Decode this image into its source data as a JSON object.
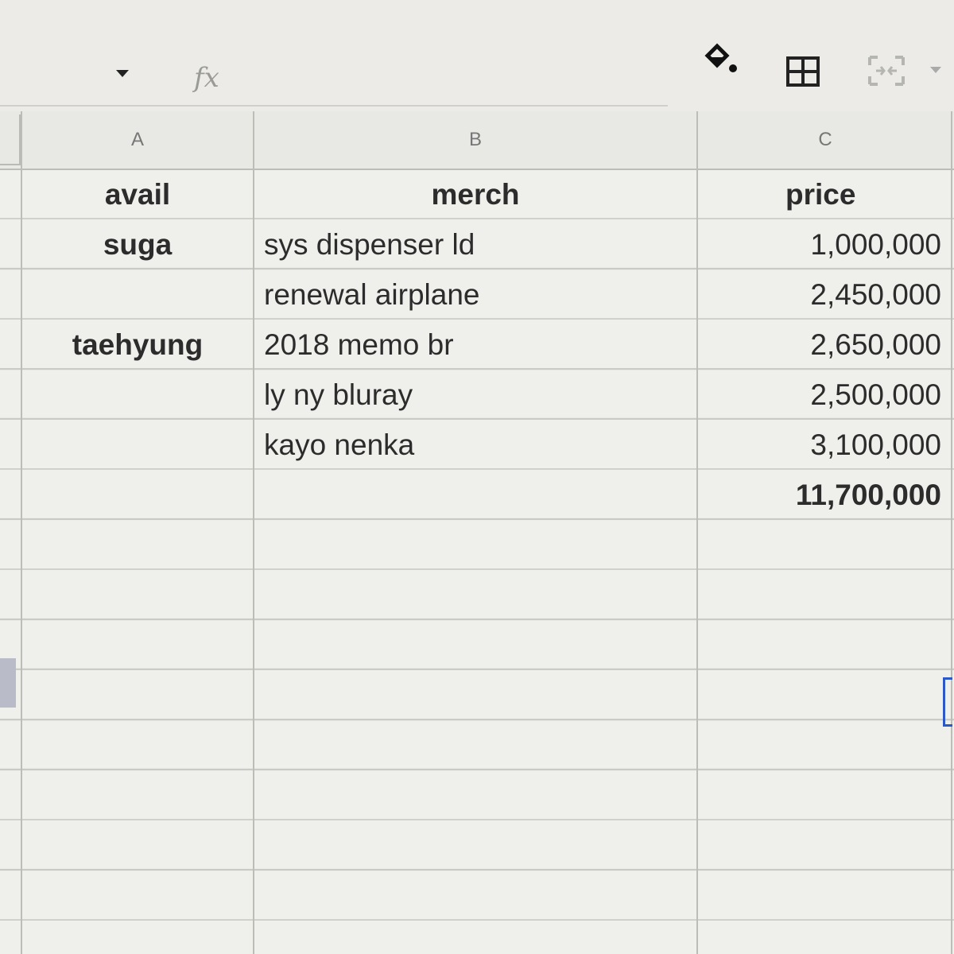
{
  "toolbar": {
    "fx_label": "fx",
    "icons": [
      "dropdown-arrow-icon",
      "fx-icon",
      "paint-format-icon",
      "borders-icon",
      "merge-cells-icon"
    ]
  },
  "columns": [
    {
      "letter": "A"
    },
    {
      "letter": "B"
    },
    {
      "letter": "C"
    }
  ],
  "sheet": {
    "headers": {
      "a": "avail",
      "b": "merch",
      "c": "price"
    },
    "rows": [
      {
        "a": "suga",
        "b": "sys dispenser ld",
        "c": "1,000,000"
      },
      {
        "a": "",
        "b": "renewal airplane",
        "c": "2,450,000"
      },
      {
        "a": "taehyung",
        "b": "2018 memo br",
        "c": "2,650,000"
      },
      {
        "a": "",
        "b": "ly ny bluray",
        "c": "2,500,000"
      },
      {
        "a": "",
        "b": "kayo nenka",
        "c": "3,100,000"
      }
    ],
    "total": "11,700,000"
  },
  "colors": {
    "selection": "#2c58c8",
    "text": "#2c2c2c"
  }
}
